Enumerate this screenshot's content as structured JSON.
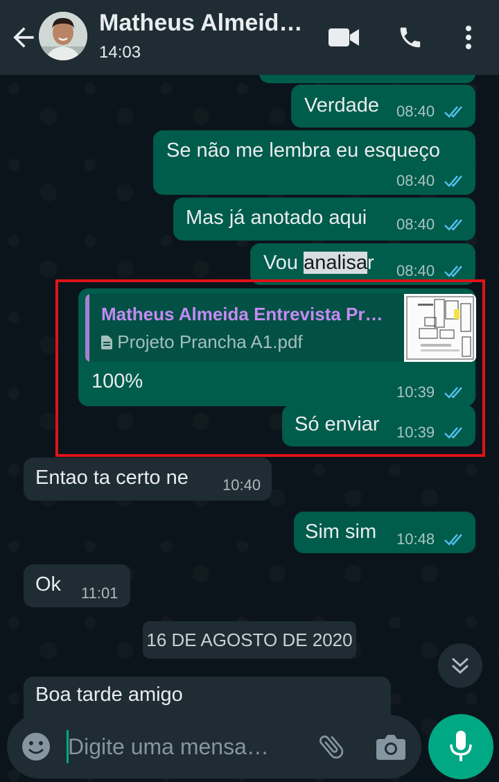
{
  "header": {
    "contact_name": "Matheus Almeid…",
    "last_seen": "14:03"
  },
  "messages": [
    {
      "text": "Verdade",
      "time": "08:40",
      "status": "read"
    },
    {
      "text": "Se não me lembra eu esqueço",
      "time": "08:40",
      "status": "read"
    },
    {
      "text": "Mas já anotado aqui",
      "time": "08:40",
      "status": "read"
    },
    {
      "text_before": "Vou ",
      "text_highlight": "analisa",
      "text_after": "r",
      "time": "08:40",
      "status": "read"
    },
    {
      "doc_title": "Matheus Almeida Entrevista Pr…",
      "doc_file": "Projeto Prancha A1.pdf",
      "text": "100%",
      "time": "10:39",
      "status": "read"
    },
    {
      "text": "Só enviar",
      "time": "10:39",
      "status": "read"
    },
    {
      "text": "Entao ta certo ne",
      "time": "10:40"
    },
    {
      "text": "Sim sim",
      "time": "10:48",
      "status": "read"
    },
    {
      "text": "Ok",
      "time": "11:01"
    },
    {
      "text": "Boa tarde amigo"
    }
  ],
  "date_divider": "16 DE AGOSTO DE 2020",
  "composer": {
    "placeholder": "Digite uma mensa…"
  },
  "colors": {
    "outgoing_bubble": "#005c4b",
    "incoming_bubble": "#1f2c34",
    "read_ticks": "#53bdeb",
    "accent": "#00a884",
    "highlight_border": "#e01218"
  },
  "icons": [
    "back-arrow-icon",
    "video-call-icon",
    "phone-icon",
    "more-vert-icon",
    "emoji-icon",
    "attach-icon",
    "camera-icon",
    "mic-icon",
    "scroll-down-icon",
    "document-icon",
    "double-check-icon"
  ]
}
